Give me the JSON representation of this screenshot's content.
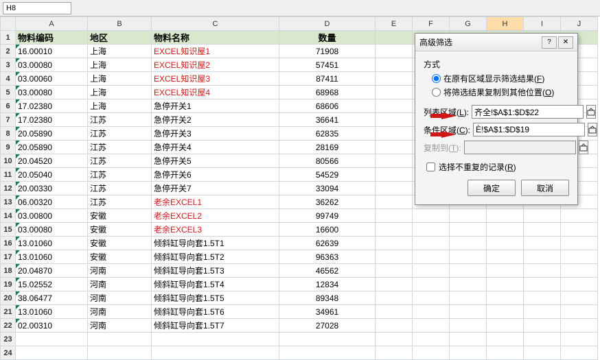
{
  "formula_bar": {
    "name_box": "H8"
  },
  "columns": [
    "A",
    "B",
    "C",
    "D",
    "E",
    "F",
    "G",
    "H",
    "I",
    "J"
  ],
  "selected_col": "H",
  "headers": {
    "A": "物料编码",
    "B": "地区",
    "C": "物料名称",
    "D": "数量"
  },
  "rows": [
    {
      "code": "16.00010",
      "region": "上海",
      "name": "EXCEL知识屋1",
      "qty": "71908",
      "red": true
    },
    {
      "code": "03.00080",
      "region": "上海",
      "name": "EXCEL知识屋2",
      "qty": "57451",
      "red": true
    },
    {
      "code": "03.00060",
      "region": "上海",
      "name": "EXCEL知识屋3",
      "qty": "87411",
      "red": true
    },
    {
      "code": "03.00080",
      "region": "上海",
      "name": "EXCEL知识屋4",
      "qty": "68968",
      "red": true
    },
    {
      "code": "17.02380",
      "region": "上海",
      "name": "急停开关1",
      "qty": "68606",
      "red": false
    },
    {
      "code": "17.02380",
      "region": "江苏",
      "name": "急停开关2",
      "qty": "36641",
      "red": false
    },
    {
      "code": "20.05890",
      "region": "江苏",
      "name": "急停开关3",
      "qty": "62835",
      "red": false
    },
    {
      "code": "20.05890",
      "region": "江苏",
      "name": "急停开关4",
      "qty": "28169",
      "red": false
    },
    {
      "code": "20.04520",
      "region": "江苏",
      "name": "急停开关5",
      "qty": "80566",
      "red": false
    },
    {
      "code": "20.05040",
      "region": "江苏",
      "name": "急停开关6",
      "qty": "54529",
      "red": false
    },
    {
      "code": "20.00330",
      "region": "江苏",
      "name": "急停开关7",
      "qty": "33094",
      "red": false
    },
    {
      "code": "06.00320",
      "region": "江苏",
      "name": "老余EXCEL1",
      "qty": "36262",
      "red": true
    },
    {
      "code": "03.00800",
      "region": "安徽",
      "name": "老余EXCEL2",
      "qty": "99749",
      "red": true
    },
    {
      "code": "03.00080",
      "region": "安徽",
      "name": "老余EXCEL3",
      "qty": "16600",
      "red": true
    },
    {
      "code": "13.01060",
      "region": "安徽",
      "name": "倾斜缸导向套1.5T1",
      "qty": "62639",
      "red": false
    },
    {
      "code": "13.01060",
      "region": "安徽",
      "name": "倾斜缸导向套1.5T2",
      "qty": "96363",
      "red": false
    },
    {
      "code": "20.04870",
      "region": "河南",
      "name": "倾斜缸导向套1.5T3",
      "qty": "46562",
      "red": false
    },
    {
      "code": "15.02552",
      "region": "河南",
      "name": "倾斜缸导向套1.5T4",
      "qty": "12834",
      "red": false
    },
    {
      "code": "38.06477",
      "region": "河南",
      "name": "倾斜缸导向套1.5T5",
      "qty": "89348",
      "red": false
    },
    {
      "code": "13.01060",
      "region": "河南",
      "name": "倾斜缸导向套1.5T6",
      "qty": "34961",
      "red": false
    },
    {
      "code": "02.00310",
      "region": "河南",
      "name": "倾斜缸导向套1.5T7",
      "qty": "27028",
      "red": false
    }
  ],
  "empty_rows": [
    23,
    24
  ],
  "dialog": {
    "title": "高级筛选",
    "help_icon": "?",
    "close_icon": "✕",
    "mode_label": "方式",
    "radio1": "在原有区域显示筛选结果(",
    "radio1_u": "F",
    "radio1_end": ")",
    "radio2": "将筛选结果复制到其他位置(",
    "radio2_u": "O",
    "radio2_end": ")",
    "list_range_label": "列表区域(",
    "list_range_u": "L",
    "list_range_end": "):",
    "list_range_value": "齐全!$A$1:$D$22",
    "cond_range_label": "条件区域(",
    "cond_range_u": "C",
    "cond_range_end": "):",
    "cond_range_value": "È!$A$1:$D$19",
    "copy_to_label": "复制到(",
    "copy_to_u": "T",
    "copy_to_end": "):",
    "copy_to_value": "",
    "unique_label": "选择不重复的记录(",
    "unique_u": "R",
    "unique_end": ")",
    "ok": "确定",
    "cancel": "取消",
    "range_icon": "⬚"
  }
}
